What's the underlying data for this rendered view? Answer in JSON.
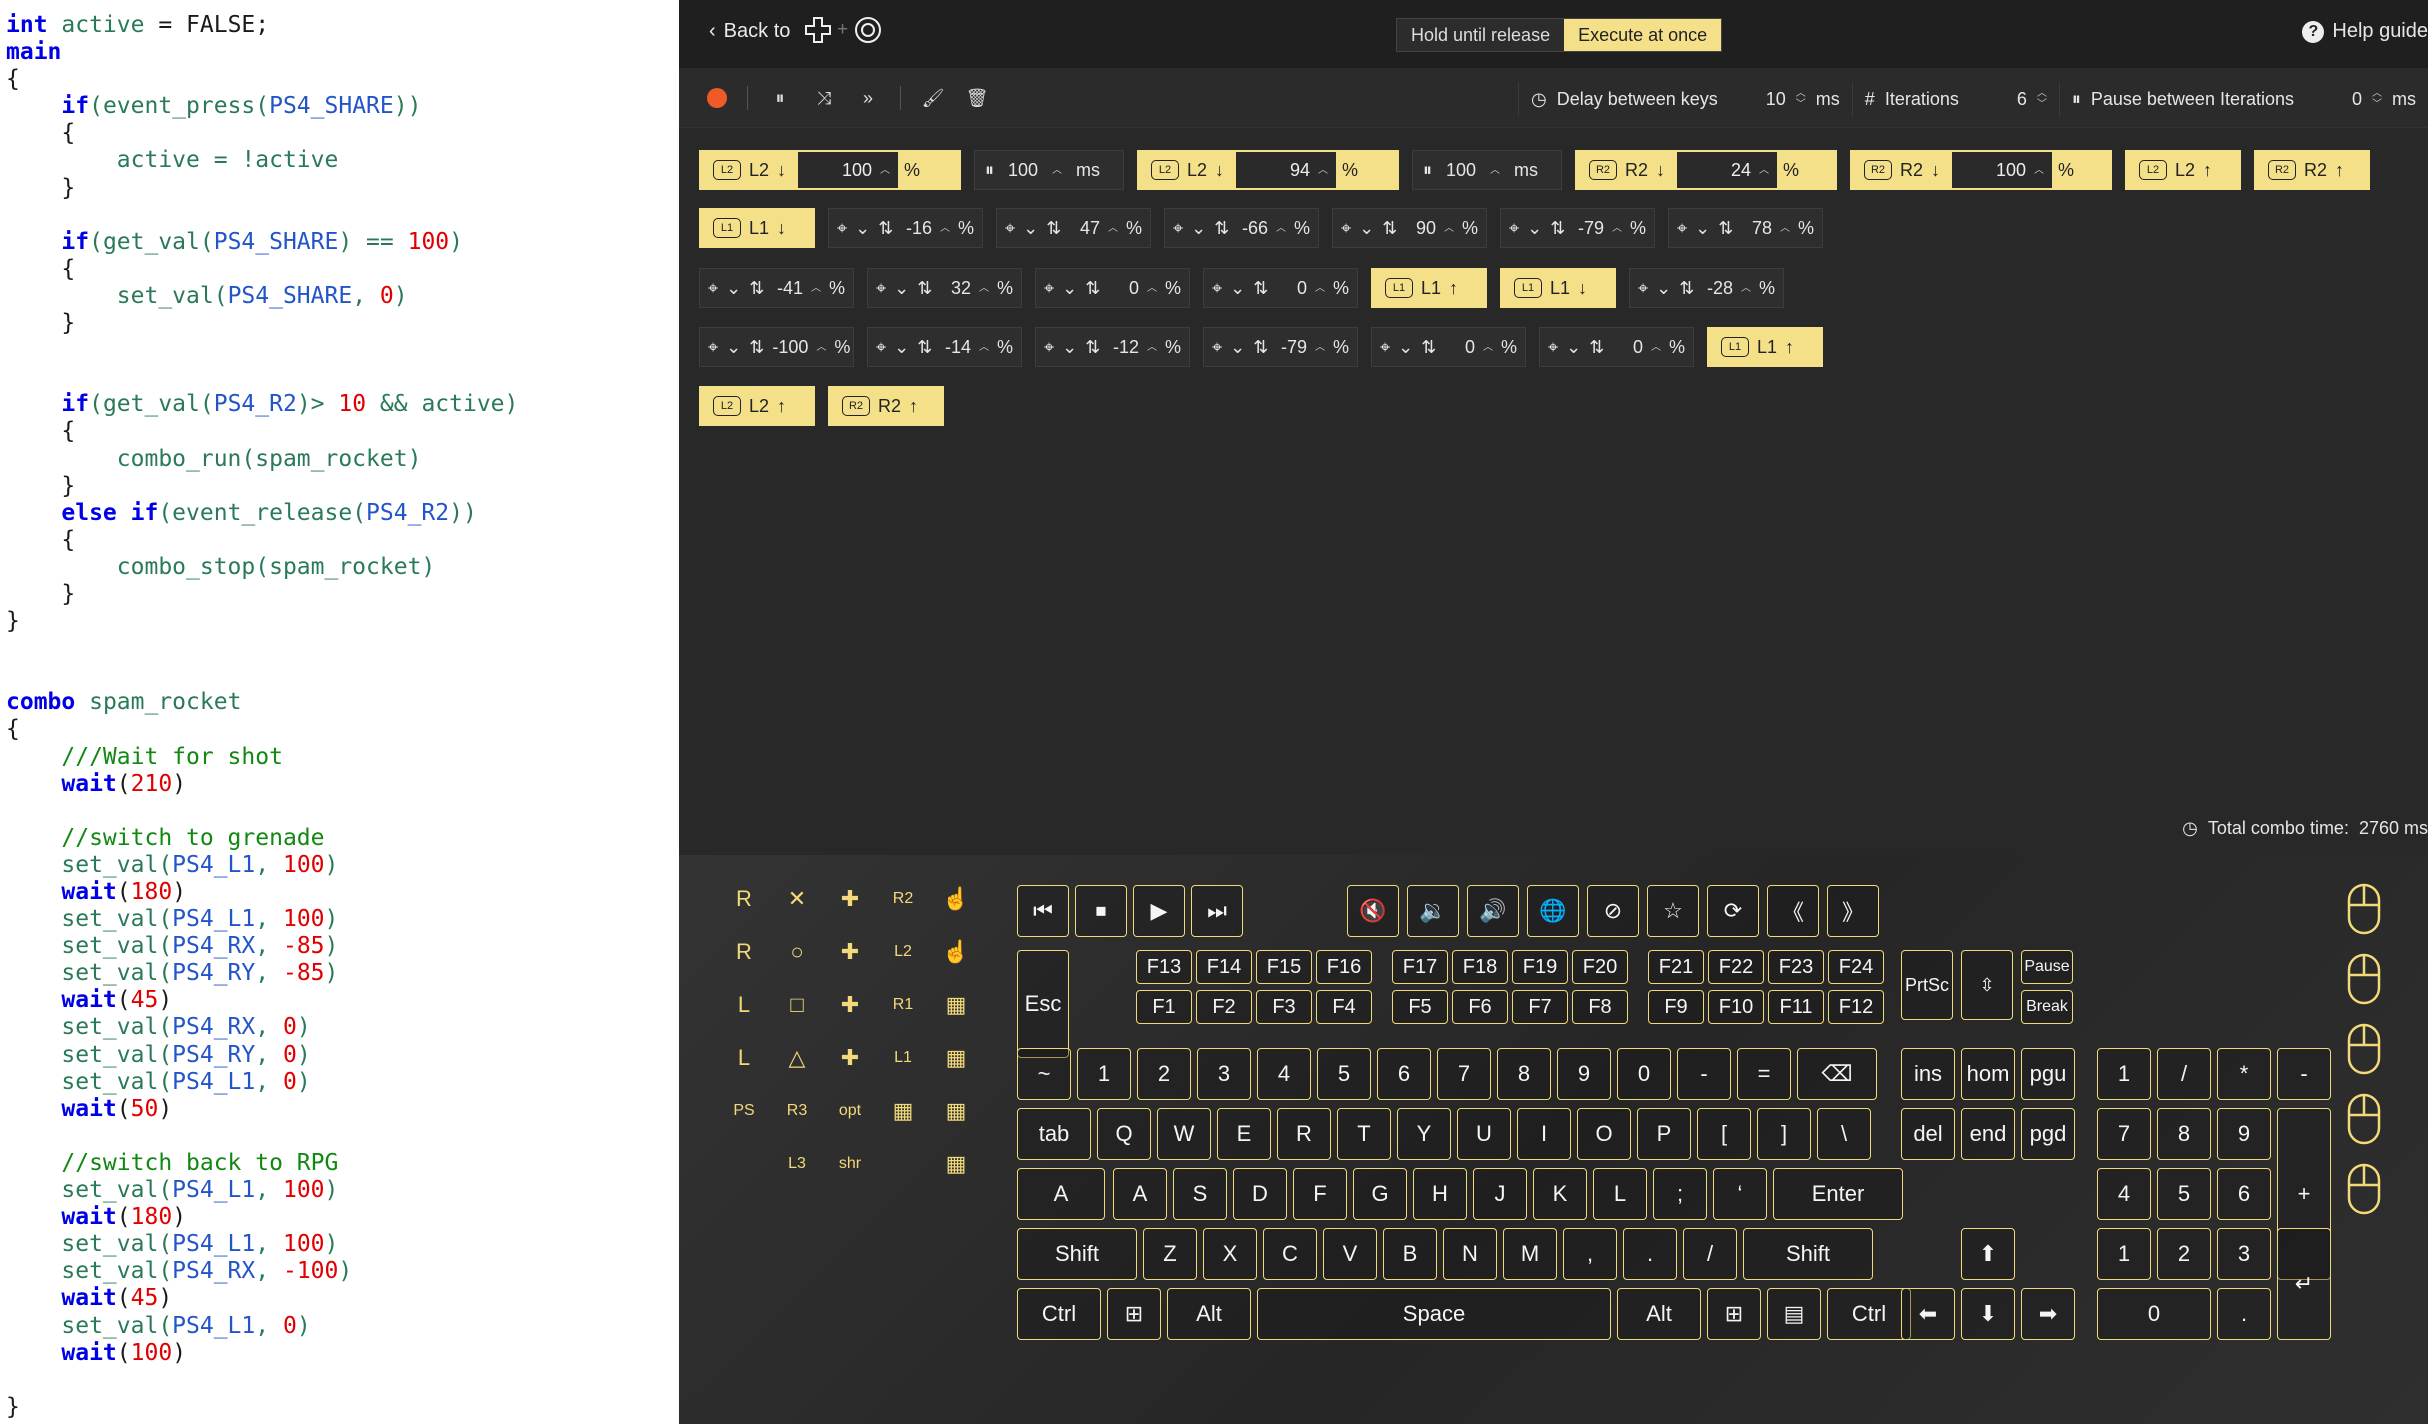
{
  "code": {
    "lines": [
      [
        [
          "kw",
          "int"
        ],
        [
          "id",
          " active"
        ],
        [
          "t",
          " = FALSE;"
        ]
      ],
      [
        [
          "kw",
          "main"
        ]
      ],
      [
        [
          "t",
          "{"
        ]
      ],
      [
        [
          "t",
          "    "
        ],
        [
          "kw",
          "if"
        ],
        [
          "id",
          "(event_press("
        ],
        [
          "cst",
          "PS4_SHARE"
        ],
        [
          "id",
          "))"
        ]
      ],
      [
        [
          "t",
          "    {"
        ]
      ],
      [
        [
          "id",
          "        active = !active"
        ]
      ],
      [
        [
          "t",
          "    }"
        ]
      ],
      [],
      [
        [
          "t",
          "    "
        ],
        [
          "kw",
          "if"
        ],
        [
          "id",
          "(get_val("
        ],
        [
          "cst",
          "PS4_SHARE"
        ],
        [
          "id",
          ") == "
        ],
        [
          "num",
          "100"
        ],
        [
          "id",
          ")"
        ]
      ],
      [
        [
          "t",
          "    {"
        ]
      ],
      [
        [
          "id",
          "        set_val("
        ],
        [
          "cst",
          "PS4_SHARE"
        ],
        [
          "id",
          ", "
        ],
        [
          "num",
          "0"
        ],
        [
          "id",
          ")"
        ]
      ],
      [
        [
          "t",
          "    }"
        ]
      ],
      [],
      [],
      [
        [
          "t",
          "    "
        ],
        [
          "kw",
          "if"
        ],
        [
          "id",
          "(get_val("
        ],
        [
          "cst",
          "PS4_R2"
        ],
        [
          "id",
          ")> "
        ],
        [
          "num",
          "10"
        ],
        [
          "id",
          " && active)"
        ]
      ],
      [
        [
          "t",
          "    {"
        ]
      ],
      [
        [
          "id",
          "        combo_run(spam_rocket)"
        ]
      ],
      [
        [
          "t",
          "    }"
        ]
      ],
      [
        [
          "t",
          "    "
        ],
        [
          "kw",
          "else if"
        ],
        [
          "id",
          "(event_release("
        ],
        [
          "cst",
          "PS4_R2"
        ],
        [
          "id",
          "))"
        ]
      ],
      [
        [
          "t",
          "    {"
        ]
      ],
      [
        [
          "id",
          "        combo_stop(spam_rocket)"
        ]
      ],
      [
        [
          "t",
          "    }"
        ]
      ],
      [
        [
          "t",
          "}"
        ]
      ],
      [],
      [],
      [
        [
          "kw",
          "combo"
        ],
        [
          "id",
          " spam_rocket"
        ]
      ],
      [
        [
          "t",
          "{"
        ]
      ],
      [
        [
          "cm",
          "    ///Wait for shot"
        ]
      ],
      [
        [
          "t",
          "    "
        ],
        [
          "kw",
          "wait"
        ],
        [
          "t",
          "("
        ],
        [
          "num",
          "210"
        ],
        [
          "t",
          ")"
        ]
      ],
      [],
      [
        [
          "cm",
          "    //switch to grenade"
        ]
      ],
      [
        [
          "id",
          "    set_val("
        ],
        [
          "cst",
          "PS4_L1"
        ],
        [
          "id",
          ", "
        ],
        [
          "num",
          "100"
        ],
        [
          "id",
          ")"
        ]
      ],
      [
        [
          "t",
          "    "
        ],
        [
          "kw",
          "wait"
        ],
        [
          "t",
          "("
        ],
        [
          "num",
          "180"
        ],
        [
          "t",
          ")"
        ]
      ],
      [
        [
          "id",
          "    set_val("
        ],
        [
          "cst",
          "PS4_L1"
        ],
        [
          "id",
          ", "
        ],
        [
          "num",
          "100"
        ],
        [
          "id",
          ")"
        ]
      ],
      [
        [
          "id",
          "    set_val("
        ],
        [
          "cst",
          "PS4_RX"
        ],
        [
          "id",
          ", "
        ],
        [
          "num",
          "-85"
        ],
        [
          "id",
          ")"
        ]
      ],
      [
        [
          "id",
          "    set_val("
        ],
        [
          "cst",
          "PS4_RY"
        ],
        [
          "id",
          ", "
        ],
        [
          "num",
          "-85"
        ],
        [
          "id",
          ")"
        ]
      ],
      [
        [
          "t",
          "    "
        ],
        [
          "kw",
          "wait"
        ],
        [
          "t",
          "("
        ],
        [
          "num",
          "45"
        ],
        [
          "t",
          ")"
        ]
      ],
      [
        [
          "id",
          "    set_val("
        ],
        [
          "cst",
          "PS4_RX"
        ],
        [
          "id",
          ", "
        ],
        [
          "num",
          "0"
        ],
        [
          "id",
          ")"
        ]
      ],
      [
        [
          "id",
          "    set_val("
        ],
        [
          "cst",
          "PS4_RY"
        ],
        [
          "id",
          ", "
        ],
        [
          "num",
          "0"
        ],
        [
          "id",
          ")"
        ]
      ],
      [
        [
          "id",
          "    set_val("
        ],
        [
          "cst",
          "PS4_L1"
        ],
        [
          "id",
          ", "
        ],
        [
          "num",
          "0"
        ],
        [
          "id",
          ")"
        ]
      ],
      [
        [
          "t",
          "    "
        ],
        [
          "kw",
          "wait"
        ],
        [
          "t",
          "("
        ],
        [
          "num",
          "50"
        ],
        [
          "t",
          ")"
        ]
      ],
      [],
      [
        [
          "cm",
          "    //switch back to RPG"
        ]
      ],
      [
        [
          "id",
          "    set_val("
        ],
        [
          "cst",
          "PS4_L1"
        ],
        [
          "id",
          ", "
        ],
        [
          "num",
          "100"
        ],
        [
          "id",
          ")"
        ]
      ],
      [
        [
          "t",
          "    "
        ],
        [
          "kw",
          "wait"
        ],
        [
          "t",
          "("
        ],
        [
          "num",
          "180"
        ],
        [
          "t",
          ")"
        ]
      ],
      [
        [
          "id",
          "    set_val("
        ],
        [
          "cst",
          "PS4_L1"
        ],
        [
          "id",
          ", "
        ],
        [
          "num",
          "100"
        ],
        [
          "id",
          ")"
        ]
      ],
      [
        [
          "id",
          "    set_val("
        ],
        [
          "cst",
          "PS4_RX"
        ],
        [
          "id",
          ", "
        ],
        [
          "num",
          "-100"
        ],
        [
          "id",
          ")"
        ]
      ],
      [
        [
          "t",
          "    "
        ],
        [
          "kw",
          "wait"
        ],
        [
          "t",
          "("
        ],
        [
          "num",
          "45"
        ],
        [
          "t",
          ")"
        ]
      ],
      [
        [
          "id",
          "    set_val("
        ],
        [
          "cst",
          "PS4_L1"
        ],
        [
          "id",
          ", "
        ],
        [
          "num",
          "0"
        ],
        [
          "id",
          ")"
        ]
      ],
      [
        [
          "t",
          "    "
        ],
        [
          "kw",
          "wait"
        ],
        [
          "t",
          "("
        ],
        [
          "num",
          "100"
        ],
        [
          "t",
          ")"
        ]
      ],
      [],
      [
        [
          "t",
          "}"
        ]
      ]
    ]
  },
  "header": {
    "back_label": "Back to",
    "mode_hold": "Hold until release",
    "mode_execute": "Execute at once",
    "help_label": "Help guide"
  },
  "toolbar": {
    "delay_label": "Delay between keys",
    "delay_value": "10",
    "delay_unit": "ms",
    "iter_label": "Iterations",
    "iter_value": "6",
    "pause_label": "Pause between Iterations",
    "pause_value": "0",
    "pause_unit": "ms"
  },
  "steps": [
    {
      "kind": "key",
      "btn": "L2",
      "arrow": "↓",
      "value": "100",
      "unit": "%"
    },
    {
      "kind": "delay",
      "value": "100",
      "unit": "ms"
    },
    {
      "kind": "key",
      "btn": "L2",
      "arrow": "↓",
      "value": "94",
      "unit": "%"
    },
    {
      "kind": "delay",
      "value": "100",
      "unit": "ms"
    },
    {
      "kind": "key",
      "btn": "R2",
      "arrow": "↓",
      "value": "24",
      "unit": "%"
    },
    {
      "kind": "key",
      "btn": "R2",
      "arrow": "↓",
      "value": "100",
      "unit": "%"
    },
    {
      "kind": "keyonly",
      "btn": "L2",
      "arrow": "↑"
    },
    {
      "kind": "keyonly",
      "btn": "R2",
      "arrow": "↑"
    },
    {
      "kind": "keyonly",
      "btn": "L1",
      "arrow": "↓"
    },
    {
      "kind": "stick",
      "value": "-16",
      "unit": "%"
    },
    {
      "kind": "stick",
      "value": "47",
      "unit": "%"
    },
    {
      "kind": "stick",
      "value": "-66",
      "unit": "%"
    },
    {
      "kind": "stick",
      "value": "90",
      "unit": "%"
    },
    {
      "kind": "stick",
      "value": "-79",
      "unit": "%"
    },
    {
      "kind": "stick",
      "value": "78",
      "unit": "%"
    },
    {
      "kind": "stick",
      "value": "-41",
      "unit": "%"
    },
    {
      "kind": "stick",
      "value": "32",
      "unit": "%"
    },
    {
      "kind": "stick",
      "value": "0",
      "unit": "%"
    },
    {
      "kind": "stick",
      "value": "0",
      "unit": "%"
    },
    {
      "kind": "keyonly",
      "btn": "L1",
      "arrow": "↑"
    },
    {
      "kind": "keyonly",
      "btn": "L1",
      "arrow": "↓"
    },
    {
      "kind": "stick",
      "value": "-28",
      "unit": "%"
    },
    {
      "kind": "stick",
      "value": "-100",
      "unit": "%"
    },
    {
      "kind": "stick",
      "value": "-14",
      "unit": "%"
    },
    {
      "kind": "stick",
      "value": "-12",
      "unit": "%"
    },
    {
      "kind": "stick",
      "value": "-79",
      "unit": "%"
    },
    {
      "kind": "stick",
      "value": "0",
      "unit": "%"
    },
    {
      "kind": "stick",
      "value": "0",
      "unit": "%"
    },
    {
      "kind": "keyonly",
      "btn": "L1",
      "arrow": "↑"
    },
    {
      "kind": "keyonly",
      "btn": "L2",
      "arrow": "↑"
    },
    {
      "kind": "keyonly",
      "btn": "R2",
      "arrow": "↑"
    }
  ],
  "status": {
    "total_label": "Total combo time:",
    "total_value": "2760 ms"
  },
  "gamepad": {
    "rows": [
      [
        "R",
        "✕",
        "✚",
        "R2",
        "☝"
      ],
      [
        "R",
        "○",
        "✚",
        "L2",
        "☝"
      ],
      [
        "L",
        "□",
        "✚",
        "R1",
        "▦"
      ],
      [
        "L",
        "△",
        "✚",
        "L1",
        "▦"
      ],
      [
        "PS",
        "R3",
        "opt",
        "▦",
        "▦"
      ],
      [
        "",
        "L3",
        "shr",
        "",
        "▦"
      ]
    ]
  },
  "keyboard": {
    "media": [
      "⏮",
      "⏹",
      "▶",
      "⏭"
    ],
    "sys": [
      "🔇",
      "🔉",
      "🔊",
      "🌐",
      "⊘",
      "☆",
      "⟳",
      "《",
      "》"
    ],
    "esc": "Esc",
    "fhigh": [
      "F13",
      "F14",
      "F15",
      "F16",
      "F17",
      "F18",
      "F19",
      "F20",
      "F21",
      "F22",
      "F23",
      "F24"
    ],
    "flow": [
      "F1",
      "F2",
      "F3",
      "F4",
      "F5",
      "F6",
      "F7",
      "F8",
      "F9",
      "F10",
      "F11",
      "F12"
    ],
    "prtsc": "PrtSc",
    "pause": "Pause",
    "brk": "Break",
    "row1": [
      "~",
      "1",
      "2",
      "3",
      "4",
      "5",
      "6",
      "7",
      "8",
      "9",
      "0",
      "-",
      "=",
      "⌫"
    ],
    "row2": [
      "tab",
      "Q",
      "W",
      "E",
      "R",
      "T",
      "Y",
      "U",
      "I",
      "O",
      "P",
      "[",
      "]",
      "\\"
    ],
    "row3": [
      "A",
      "A",
      "S",
      "D",
      "F",
      "G",
      "H",
      "J",
      "K",
      "L",
      ";",
      "‘",
      "Enter"
    ],
    "row4": [
      "Shift",
      "Z",
      "X",
      "C",
      "V",
      "B",
      "N",
      "M",
      ",",
      ".",
      "/",
      "Shift"
    ],
    "row5": [
      "Ctrl",
      "⊞",
      "Alt",
      "Space",
      "Alt",
      "⊞",
      "▤",
      "Ctrl"
    ],
    "nav": [
      "ins",
      "hom",
      "pgu",
      "del",
      "end",
      "pgd"
    ],
    "arrows": [
      "⬆",
      "⬅",
      "⬇",
      "➡"
    ],
    "num": [
      "1",
      "/",
      "*",
      "-",
      "7",
      "8",
      "9",
      "+",
      "4",
      "5",
      "6",
      "1",
      "2",
      "3",
      "↵",
      "0",
      "."
    ]
  }
}
